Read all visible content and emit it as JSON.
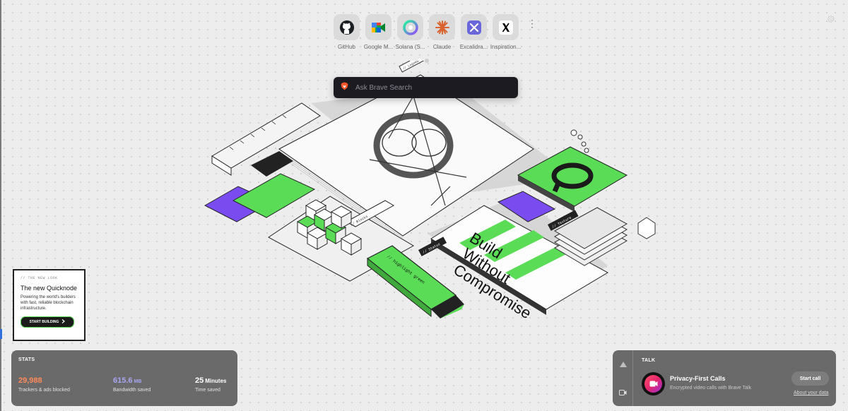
{
  "top_sites": [
    {
      "label": "GitHub",
      "icon": "github-icon"
    },
    {
      "label": "Google M...",
      "icon": "google-meet-icon"
    },
    {
      "label": "Solana (S...",
      "icon": "solana-icon"
    },
    {
      "label": "Claude",
      "icon": "claude-icon"
    },
    {
      "label": "Excalidra...",
      "icon": "excalidraw-icon"
    },
    {
      "label": "Inspiration...",
      "icon": "x-icon"
    }
  ],
  "top_sites_more": "⋮",
  "search": {
    "placeholder": "Ask Brave Search",
    "icon": "brave-lion-icon"
  },
  "hero": {
    "headline_lines": [
      "Build",
      "Without",
      "Compromise"
    ],
    "tag_highlight": "// highlight green",
    "tag_status": "// Status",
    "tag_blocks": "// Blocks",
    "tag_texture": "// Texture",
    "tag_logo": "// Logomark",
    "accent_green": "#5adc57",
    "accent_purple": "#7a4cf0"
  },
  "sponsor": {
    "kicker": "// THE NEW LOOK",
    "title": "The new Quicknode",
    "description": "Powering the world's builders with fast, reliable blockchain infrastructure.",
    "cta": "START BUILDING",
    "cta_icon": "chevron-right-icon"
  },
  "stats": {
    "title": "STATS",
    "items": [
      {
        "value": "29,988",
        "unit": "",
        "caption": "Trackers & ads blocked",
        "color": "#ff8a5a"
      },
      {
        "value": "615.6",
        "unit": "MB",
        "caption": "Bandwidth saved",
        "color": "#a9a6f2"
      },
      {
        "value": "25",
        "unit": "Minutes",
        "caption": "Time saved",
        "color": "#ffffff"
      }
    ]
  },
  "talk": {
    "title": "TALK",
    "heading": "Privacy-First Calls",
    "subtitle": "Encrypted video calls with Brave Talk",
    "button": "Start call",
    "link": "About your data"
  }
}
